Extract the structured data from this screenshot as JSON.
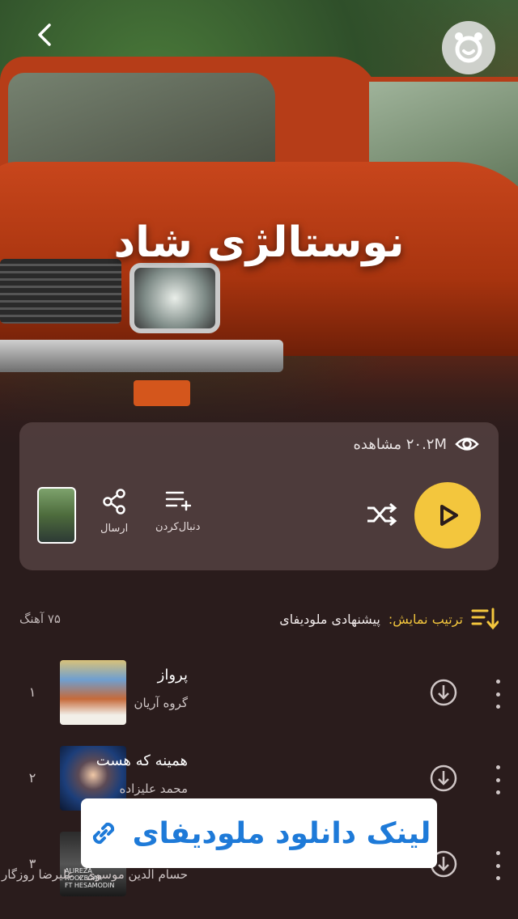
{
  "hero": {
    "title": "نوستالژی شاد"
  },
  "stats": {
    "views": "۲۰.۲M مشاهده"
  },
  "actions": {
    "follow_label": "دنبال‌کردن",
    "share_label": "ارسال"
  },
  "list_header": {
    "sort_label": "ترتیب نمایش:",
    "sort_value": "پیشنهادی ملودیفای",
    "count": "۷۵ آهنگ"
  },
  "tracks": [
    {
      "num": "۱",
      "title": "پرواز",
      "artist": "گروه آریان"
    },
    {
      "num": "۲",
      "title": "همینه که هست",
      "artist": "محمد علیزاده"
    },
    {
      "num": "۳",
      "title": "",
      "artist": "حسام الدین موسوی ، علیرضا روزگار"
    }
  ],
  "cover_texts": {
    "track3_line1": "ALIREZA ROOZEGAR",
    "track3_line2": "FT HESAMODIN"
  },
  "banner": {
    "text": "لینک دانلود ملودیفای"
  },
  "colors": {
    "accent": "#f3c63d",
    "background": "#2a1c1c",
    "link": "#1e7ad8"
  }
}
